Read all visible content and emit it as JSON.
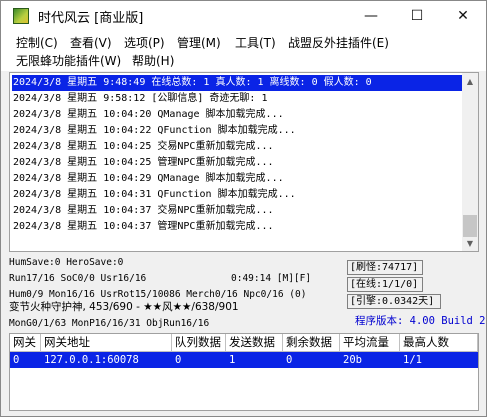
{
  "window": {
    "title": "时代风云 [商业版]",
    "controls": {
      "minimize": "—",
      "maximize": "☐",
      "close": "✕"
    }
  },
  "menu": [
    "控制(C)",
    "查看(V)",
    "选项(P)",
    "管理(M)",
    "工具(T)",
    "战盟反外挂插件(E)",
    "无限蜂功能插件(W)",
    "帮助(H)"
  ],
  "log": {
    "lines": [
      "2024/3/8 星期五 9:48:49 在线总数: 1 真人数: 1 离线数: 0 假人数: 0",
      "2024/3/8 星期五 9:58:12 [公聊信息] 奇迹无聊: 1",
      "2024/3/8 星期五 10:04:20 QManage 脚本加载完成...",
      "2024/3/8 星期五 10:04:22 QFunction 脚本加载完成...",
      "2024/3/8 星期五 10:04:25 交易NPC重新加载完成...",
      "2024/3/8 星期五 10:04:25 管理NPC重新加载完成...",
      "2024/3/8 星期五 10:04:29 QManage 脚本加载完成...",
      "2024/3/8 星期五 10:04:31 QFunction 脚本加载完成...",
      "2024/3/8 星期五 10:04:37 交易NPC重新加载完成...",
      "2024/3/8 星期五 10:04:37 管理NPC重新加载完成..."
    ],
    "selected_index": 0
  },
  "status": {
    "line1": "HumSave:0 HeroSave:0",
    "line2": "Run17/16 SoC0/0 Usr16/16",
    "time": "0:49:14 [M][F]",
    "line3": "Hum0/9 Mon16/16 UsrRot15/10086 Merch0/16 Npc0/16 (0)",
    "line4": "变节火种守护神, 453/690 - ★★风★★/638/901",
    "line5": "MonG0/1/63 MonP16/16/31 ObjRun16/16",
    "refresh": "[刷怪:74717]",
    "online": "[在线:1/1/0]",
    "engine": "[引擎:0.0342天]",
    "version": "程序版本: 4.00 Build 20151104"
  },
  "table": {
    "columns": [
      "网关",
      "网关地址",
      "队列数据",
      "发送数据",
      "剩余数据",
      "平均流量",
      "最高人数"
    ],
    "rows": [
      [
        "0",
        "127.0.0.1:60078",
        "0",
        "1",
        "0",
        "20b",
        "1/1"
      ]
    ]
  }
}
